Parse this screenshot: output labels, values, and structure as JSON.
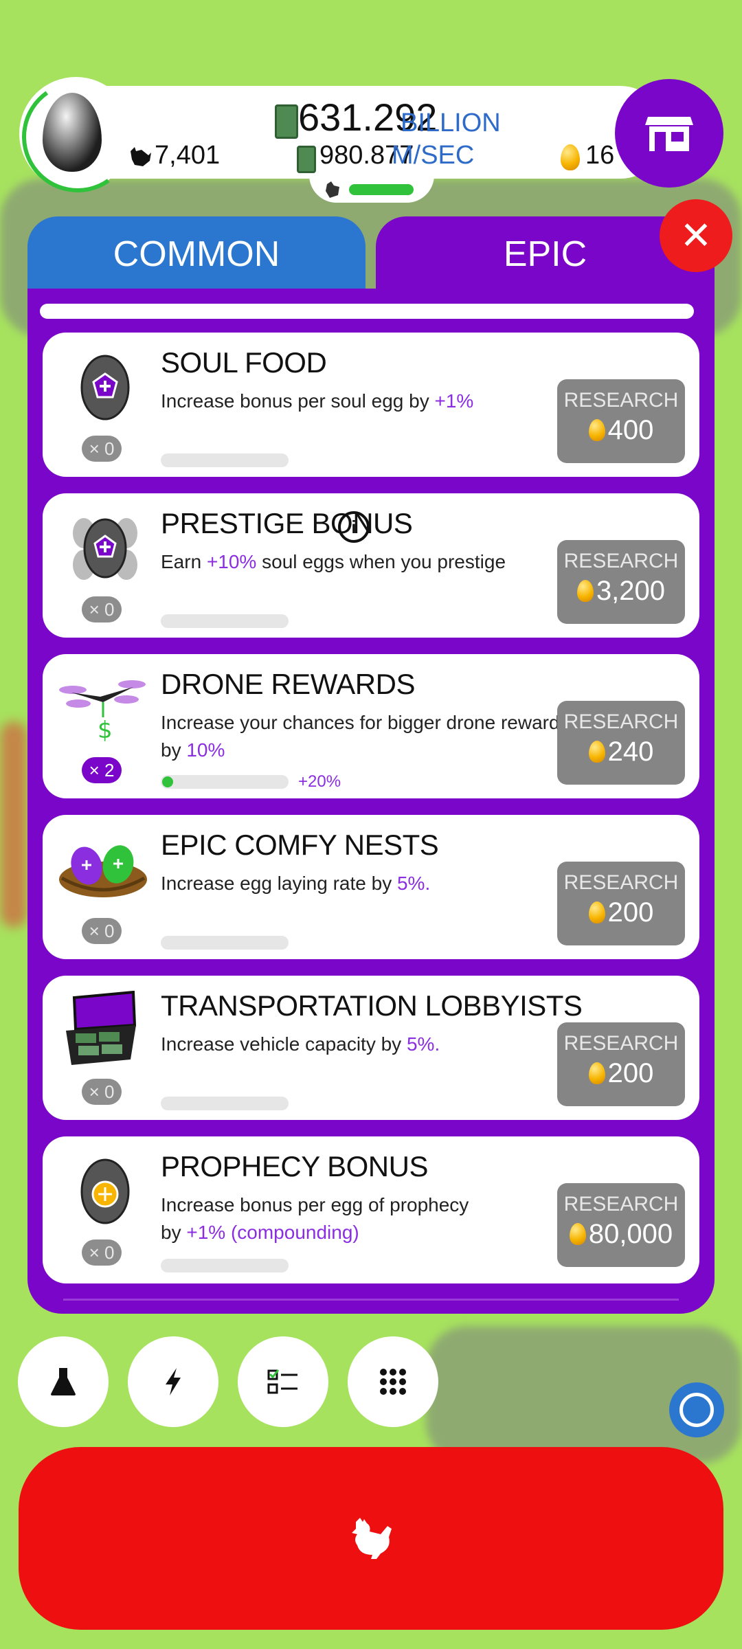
{
  "header": {
    "money_value": "631.292",
    "money_unit": "BILLION",
    "rate_value": "980.877",
    "rate_unit": "M/SEC",
    "chickens": "7,401",
    "golden_eggs": "16"
  },
  "tabs": [
    {
      "label": "COMMON",
      "active": false
    },
    {
      "label": "EPIC",
      "active": true
    }
  ],
  "close_symbol": "✕",
  "research_items": [
    {
      "title": "SOUL FOOD",
      "desc_pre": "Increase bonus per soul egg by ",
      "desc_hl": "+1%",
      "desc_post": "",
      "count": "× 0",
      "button_label": "RESEARCH",
      "cost": "400",
      "progress": 0
    },
    {
      "title": "PRESTIGE BONUS",
      "desc_pre": "Earn ",
      "desc_hl": "+10%",
      "desc_post": " soul eggs when you prestige",
      "count": "× 0",
      "button_label": "RESEARCH",
      "cost": "3,200",
      "progress": 0
    },
    {
      "title": "DRONE REWARDS",
      "desc_pre": "Increase your chances for bigger drone rewards by ",
      "desc_hl": "10%",
      "desc_post": "",
      "count": "× 2",
      "button_label": "RESEARCH",
      "cost": "240",
      "progress": 0.04,
      "progress_label": "+20%"
    },
    {
      "title": "EPIC COMFY NESTS",
      "desc_pre": "Increase egg laying rate by ",
      "desc_hl": "5%.",
      "desc_post": "",
      "count": "× 0",
      "button_label": "RESEARCH",
      "cost": "200",
      "progress": 0
    },
    {
      "title": "TRANSPORTATION LOBBYISTS",
      "desc_pre": "Increase vehicle capacity by ",
      "desc_hl": "5%.",
      "desc_post": "",
      "count": "× 0",
      "button_label": "RESEARCH",
      "cost": "200",
      "progress": 0
    },
    {
      "title": "PROPHECY BONUS",
      "desc_pre": "Increase bonus per egg of prophecy by ",
      "desc_hl": "+1% (compounding)",
      "desc_post": "",
      "count": "× 0",
      "button_label": "RESEARCH",
      "cost": "80,000",
      "progress": 0
    }
  ],
  "bottom_nav": [
    "flask-icon",
    "lightning-icon",
    "checklist-icon",
    "grid-icon"
  ],
  "colors": {
    "background": "#a6e25e",
    "epic_purple": "#7a06c9",
    "common_blue": "#2b77cf",
    "close_red": "#ee1c1c",
    "hatch_red": "#ee1010",
    "highlight": "#8a2ee0"
  }
}
